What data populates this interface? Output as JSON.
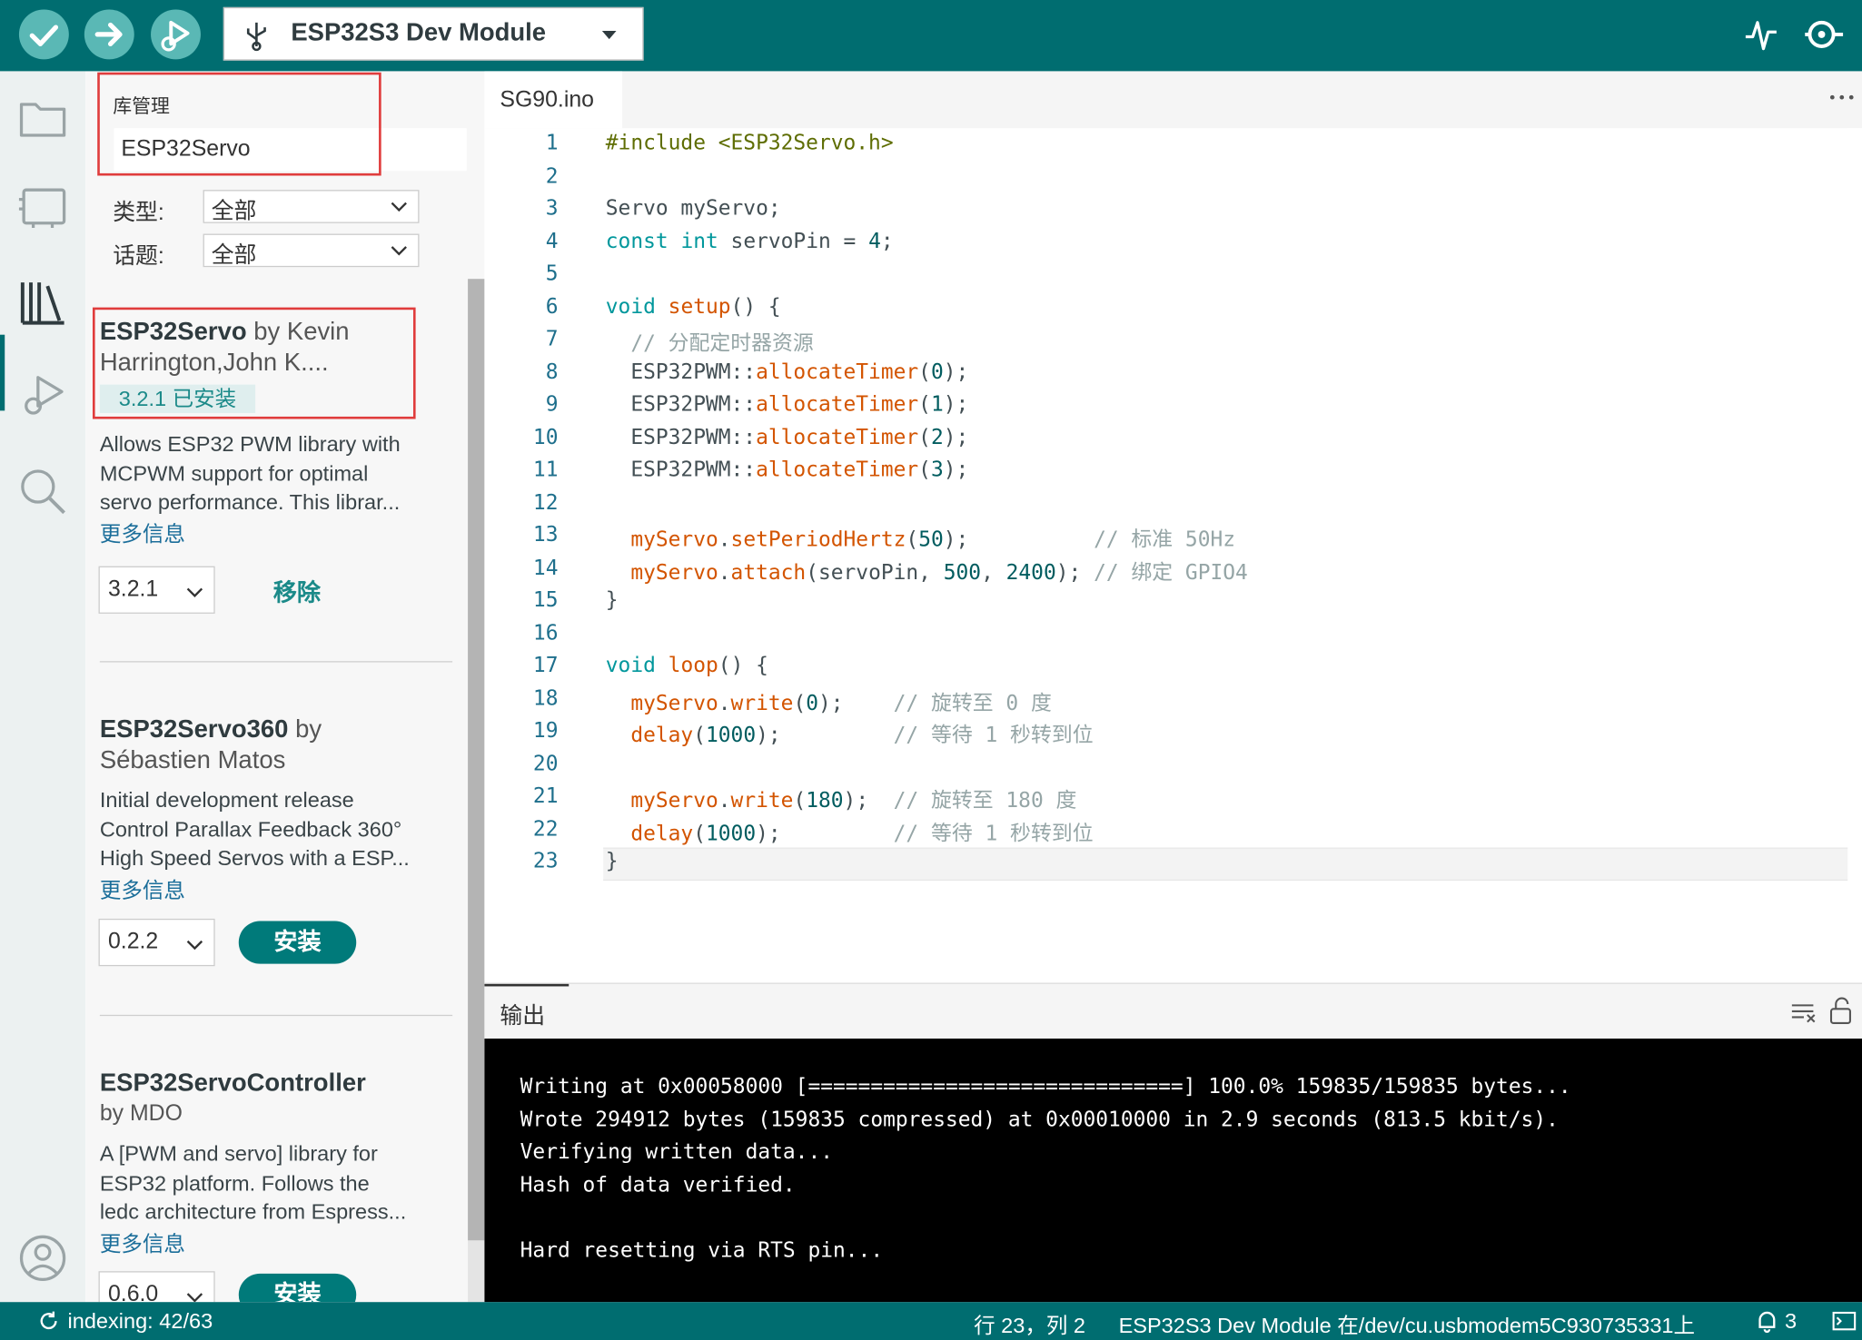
{
  "toolbar": {
    "board": "ESP32S3 Dev Module",
    "verify_icon": "check-icon",
    "upload_icon": "arrow-right-icon",
    "debug_icon": "debug-icon"
  },
  "library_manager": {
    "title": "库管理",
    "search_value": "ESP32Servo",
    "filters": {
      "type_label": "类型:",
      "type_value": "全部",
      "topic_label": "话题:",
      "topic_value": "全部"
    },
    "libraries": [
      {
        "name": "ESP32Servo",
        "by": "by Kevin",
        "author_line2": "Harrington,John K....",
        "installed_badge": "3.2.1 已安装",
        "desc": [
          "Allows ESP32 PWM library with",
          "MCPWM support for optimal",
          "servo performance. This librar..."
        ],
        "more": "更多信息",
        "version": "3.2.1",
        "action": "移除"
      },
      {
        "name": "ESP32Servo360",
        "by": "by",
        "author_line2": "Sébastien Matos",
        "desc": [
          "Initial development release",
          "Control Parallax Feedback 360°",
          "High Speed Servos with a ESP..."
        ],
        "more": "更多信息",
        "version": "0.2.2",
        "action": "安装"
      },
      {
        "name": "ESP32ServoController",
        "by": "",
        "author_line2": "by MDO",
        "desc": [
          "A [PWM and servo] library for",
          "ESP32 platform. Follows the",
          "ledc architecture from Espress..."
        ],
        "more": "更多信息",
        "version": "0.6.0",
        "action": "安装"
      }
    ]
  },
  "editor": {
    "tab": "SG90.ino",
    "line_numbers": [
      "1",
      "2",
      "3",
      "4",
      "5",
      "6",
      "7",
      "8",
      "9",
      "10",
      "11",
      "12",
      "13",
      "14",
      "15",
      "16",
      "17",
      "18",
      "19",
      "20",
      "21",
      "22",
      "23"
    ],
    "code": {
      "l1": [
        "#include <ESP32Servo.h>"
      ],
      "l3": [
        "Servo myServo;"
      ],
      "l4": [
        "const",
        " ",
        "int",
        " servoPin = ",
        "4",
        ";"
      ],
      "l6": [
        "void",
        " ",
        "setup",
        "() {"
      ],
      "l7": [
        "  // 分配定时器资源"
      ],
      "l8": [
        "  ESP32PWM::",
        "allocateTimer",
        "(",
        "0",
        ");"
      ],
      "l9": [
        "  ESP32PWM::",
        "allocateTimer",
        "(",
        "1",
        ");"
      ],
      "l10": [
        "  ESP32PWM::",
        "allocateTimer",
        "(",
        "2",
        ");"
      ],
      "l11": [
        "  ESP32PWM::",
        "allocateTimer",
        "(",
        "3",
        ");"
      ],
      "l13": [
        "  ",
        "myServo",
        ".",
        "setPeriodHertz",
        "(",
        "50",
        ");          ",
        "// 标准 50Hz"
      ],
      "l14": [
        "  ",
        "myServo",
        ".",
        "attach",
        "(servoPin, ",
        "500",
        ", ",
        "2400",
        "); ",
        "// 绑定 GPIO4"
      ],
      "l15": [
        "}"
      ],
      "l17": [
        "void",
        " ",
        "loop",
        "() {"
      ],
      "l18": [
        "  ",
        "myServo",
        ".",
        "write",
        "(",
        "0",
        ");    ",
        "// 旋转至 0 度"
      ],
      "l19": [
        "  ",
        "delay",
        "(",
        "1000",
        ");         ",
        "// 等待 1 秒转到位"
      ],
      "l21": [
        "  ",
        "myServo",
        ".",
        "write",
        "(",
        "180",
        ");  ",
        "// 旋转至 180 度"
      ],
      "l22": [
        "  ",
        "delay",
        "(",
        "1000",
        ");         ",
        "// 等待 1 秒转到位"
      ],
      "l23": [
        "}"
      ]
    }
  },
  "output": {
    "title": "输出",
    "lines": [
      "Writing at 0x00058000 [==============================] 100.0% 159835/159835 bytes...",
      "Wrote 294912 bytes (159835 compressed) at 0x00010000 in 2.9 seconds (813.5 kbit/s).",
      "Verifying written data...",
      "Hash of data verified.",
      "",
      "Hard resetting via RTS pin..."
    ]
  },
  "status": {
    "indexing": "indexing: 42/63",
    "position": "行 23，列 2",
    "board_port": "ESP32S3 Dev Module 在/dev/cu.usbmodem5C930735331上",
    "notifications": "3"
  },
  "colors": {
    "brand": "#006d70",
    "accent": "#00979c",
    "highlight_box": "#e03c3c"
  }
}
